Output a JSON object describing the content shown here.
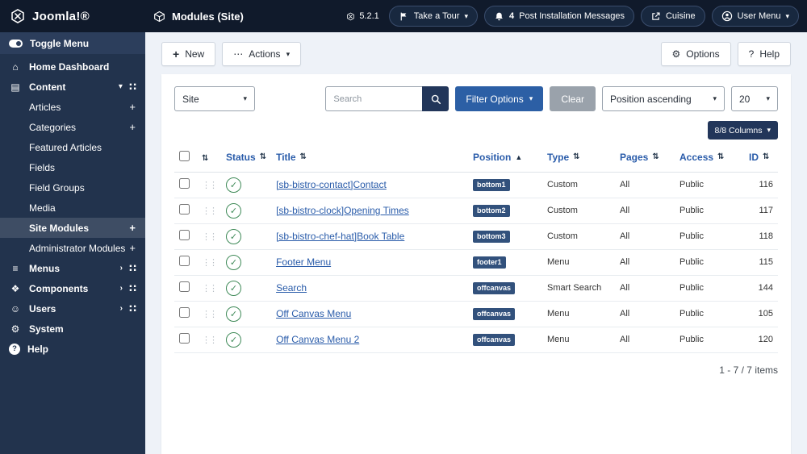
{
  "topbar": {
    "logo_text": "Joomla!®",
    "page_title": "Modules (Site)",
    "version": "5.2.1",
    "tour_label": "Take a Tour",
    "notif_count": "4",
    "post_install_label": "Post Installation Messages",
    "preview_label": "Cuisine",
    "user_menu_label": "User Menu"
  },
  "sidebar": {
    "toggle_label": "Toggle Menu",
    "items": {
      "home": "Home Dashboard",
      "content": "Content",
      "menus": "Menus",
      "components": "Components",
      "users": "Users",
      "system": "System",
      "help": "Help"
    },
    "content_children": [
      {
        "label": "Articles",
        "plus": "+"
      },
      {
        "label": "Categories",
        "plus": "+"
      },
      {
        "label": "Featured Articles"
      },
      {
        "label": "Fields"
      },
      {
        "label": "Field Groups"
      },
      {
        "label": "Media"
      },
      {
        "label": "Site Modules",
        "plus": "+",
        "active": true
      },
      {
        "label": "Administrator Modules",
        "plus": "+"
      }
    ]
  },
  "toolbar": {
    "new": "New",
    "actions": "Actions",
    "options": "Options",
    "help": "Help"
  },
  "filterbar": {
    "client_select": "Site",
    "search_placeholder": "Search",
    "filter_options": "Filter Options",
    "clear": "Clear",
    "sort_select": "Position ascending",
    "limit_select": "20",
    "columns_button": "8/8 Columns"
  },
  "table": {
    "headers": {
      "status": "Status",
      "title": "Title",
      "position": "Position",
      "type": "Type",
      "pages": "Pages",
      "access": "Access",
      "id": "ID"
    },
    "rows": [
      {
        "title": "[sb-bistro-contact]Contact",
        "position": "bottom1",
        "type": "Custom",
        "pages": "All",
        "access": "Public",
        "id": "116"
      },
      {
        "title": "[sb-bistro-clock]Opening Times",
        "position": "bottom2",
        "type": "Custom",
        "pages": "All",
        "access": "Public",
        "id": "117"
      },
      {
        "title": "[sb-bistro-chef-hat]Book Table",
        "position": "bottom3",
        "type": "Custom",
        "pages": "All",
        "access": "Public",
        "id": "118"
      },
      {
        "title": "Footer Menu",
        "position": "footer1",
        "type": "Menu",
        "pages": "All",
        "access": "Public",
        "id": "115"
      },
      {
        "title": "Search",
        "position": "offcanvas",
        "type": "Smart Search",
        "pages": "All",
        "access": "Public",
        "id": "144"
      },
      {
        "title": "Off Canvas Menu",
        "position": "offcanvas",
        "type": "Menu",
        "pages": "All",
        "access": "Public",
        "id": "105"
      },
      {
        "title": "Off Canvas Menu 2",
        "position": "offcanvas",
        "type": "Menu",
        "pages": "All",
        "access": "Public",
        "id": "120"
      }
    ],
    "pagination": "1 - 7 / 7 items"
  },
  "icons": {
    "home": "⌂",
    "content": "▤",
    "menus": "≡",
    "components": "❖",
    "users": "☺",
    "system": "⚙",
    "gear": "⚙",
    "question": "?",
    "chevron_down": "▾",
    "chevron_right": "›",
    "grid": "∷",
    "sort": "⇅",
    "sort_asc": "▲",
    "plus": "+",
    "ellipsis": "⋯",
    "drag": "⋮⋮",
    "check": "✓"
  },
  "colors": {
    "topbar_bg": "#101a2b",
    "sidebar_bg": "#22334d",
    "main_bg": "#eef2f8",
    "link_blue": "#2a5caa",
    "primary_button": "#2c5fa5",
    "dark_button": "#22365a",
    "clear_button": "#9aa2ab",
    "badge_bg": "#32517c",
    "status_green": "#3f8a58"
  }
}
